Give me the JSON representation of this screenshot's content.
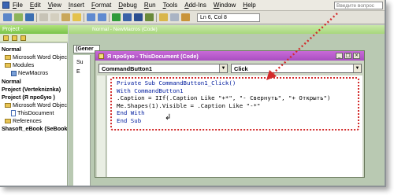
{
  "menu": {
    "items": [
      "File",
      "Edit",
      "View",
      "Insert",
      "Format",
      "Debug",
      "Run",
      "Tools",
      "Add-Ins",
      "Window",
      "Help"
    ],
    "ask_placeholder": "Введите вопрос"
  },
  "toolbar": {
    "position_text": "Ln 6, Col 8"
  },
  "project_panel": {
    "title": "Project -",
    "nodes": [
      "Normal",
      "Microsoft Word Objects",
      "Modules",
      "NewMacros",
      "Normal",
      "Project (Vertekniznka)",
      "Project (Я пробую )",
      "Microsoft Word Objects",
      "ThisDocument",
      "References",
      "Shasoft_eBook (SeBook)"
    ]
  },
  "background_window": {
    "title": "Normal - NewMacros (Code)",
    "general_combo": "(Gener",
    "gutter_text": [
      "Su",
      "E"
    ]
  },
  "code_window": {
    "title": "Я пробую - ThisDocument (Code)",
    "object_combo": "CommandButton1",
    "proc_combo": "Click",
    "lines": [
      "Private Sub CommandButton1_Click()",
      "With CommandButton1",
      ".Caption = IIf(.Caption Like \"+*\", \"- Свернуть\", \"+ Открыть\")",
      "Me.Shapes(1).Visible = .Caption Like \"-*\"",
      "End With",
      "End Sub"
    ]
  },
  "colors": {
    "annotation_red": "#d22a2a",
    "title_purple": "#b056c8",
    "title_green": "#8ccd5e"
  }
}
